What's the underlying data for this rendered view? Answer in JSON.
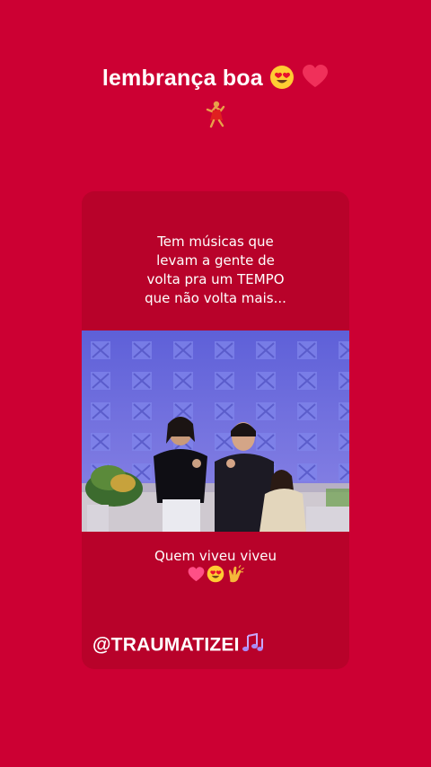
{
  "story": {
    "title": "lembrança boa",
    "title_emojis": [
      "smiling-face-with-heart-eyes",
      "red-heart"
    ],
    "sticker_icon": "dancing-person",
    "background_color": "#cc0033"
  },
  "post": {
    "caption_top": "Tem músicas que\nlevam a gente de\nvolta pra um TEMPO\nque não volta mais...",
    "video_alt": "two singers performing on a TV stage",
    "caption_bottom": "Quem viveu viveu",
    "caption_emojis": [
      "pink-heart",
      "smiling-face-with-heart-eyes",
      "clapping-hands"
    ],
    "handle": "@TRAUMATIZEI",
    "handle_icon": "musical-notes",
    "card_color": "#b8022a"
  }
}
